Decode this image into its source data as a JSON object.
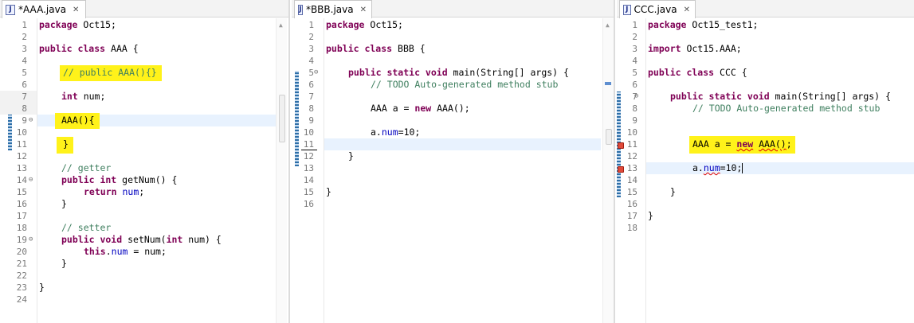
{
  "editors": [
    {
      "tab_title": "*AAA.java",
      "lines": [
        "1",
        "2",
        "3",
        "4",
        "5",
        "6",
        "7",
        "8",
        "9",
        "10",
        "11",
        "12",
        "13",
        "14",
        "15",
        "16",
        "17",
        "18",
        "19",
        "20",
        "21",
        "22",
        "23",
        "24"
      ],
      "code": {
        "l1_kw": "package",
        "l1_rest": " Oct15;",
        "l3_kw": "public class",
        "l3_rest": " AAA {",
        "l5_comment": "// public AAA(){}",
        "l7_kw": "int",
        "l7_rest": " num;",
        "l9_text": "AAA(){",
        "l11_text": "}",
        "l13_comment": "// getter",
        "l14_kw": "public int",
        "l14_rest": " getNum() {",
        "l15_kw": "return",
        "l15_field": "num",
        "l15_tail": ";",
        "l16_text": "}",
        "l18_comment": "// setter",
        "l19_kw": "public void",
        "l19_rest": " setNum(",
        "l19_kw2": "int",
        "l19_rest2": " num) {",
        "l20_kw": "this",
        "l20_dot": ".",
        "l20_field": "num",
        "l20_rest": " = num;",
        "l21_text": "}",
        "l23_text": "}"
      }
    },
    {
      "tab_title": "*BBB.java",
      "lines": [
        "1",
        "2",
        "3",
        "4",
        "5",
        "6",
        "7",
        "8",
        "9",
        "10",
        "11",
        "12",
        "13",
        "14",
        "15",
        "16"
      ],
      "code": {
        "l1_kw": "package",
        "l1_rest": " Oct15;",
        "l3_kw": "public class",
        "l3_rest": " BBB {",
        "l5_kw": "public static void",
        "l5_rest": " main(String[] args) {",
        "l6_comment": "// TODO Auto-generated method stub",
        "l8_kw_new_pre": "AAA a = ",
        "l8_kw": "new",
        "l8_rest": " AAA();",
        "l10_pre": "a.",
        "l10_field": "num",
        "l10_rest": "=10;",
        "l12_text": "}",
        "l15_text": "}"
      }
    },
    {
      "tab_title": "CCC.java",
      "lines": [
        "1",
        "2",
        "3",
        "4",
        "5",
        "6",
        "7",
        "8",
        "9",
        "10",
        "11",
        "12",
        "13",
        "14",
        "15",
        "16",
        "17",
        "18"
      ],
      "code": {
        "l1_kw": "package",
        "l1_rest": " Oct15_test1;",
        "l3_kw": "import",
        "l3_rest": " Oct15.AAA;",
        "l5_kw": "public class",
        "l5_rest": " CCC {",
        "l7_kw": "public static void",
        "l7_rest": " main(String[] args) {",
        "l8_comment": "// TODO Auto-generated method stub",
        "l11_pre": "AAA a = ",
        "l11_new": "new",
        "l11_sp": " ",
        "l11_ctor": "AAA()",
        "l11_end": ";",
        "l13_pre": "a.",
        "l13_field": "num",
        "l13_rest": "=10;",
        "l15_text": "}",
        "l17_text": "}"
      }
    }
  ],
  "colors": {
    "keyword": "#7f0055",
    "comment": "#3f7f5f",
    "field": "#0000c0",
    "highlight": "#fff21a",
    "current_line": "#e8f2fe"
  },
  "icons": [
    "java-file-icon",
    "close-tab-icon",
    "fold-collapse-icon",
    "error-marker-icon"
  ]
}
